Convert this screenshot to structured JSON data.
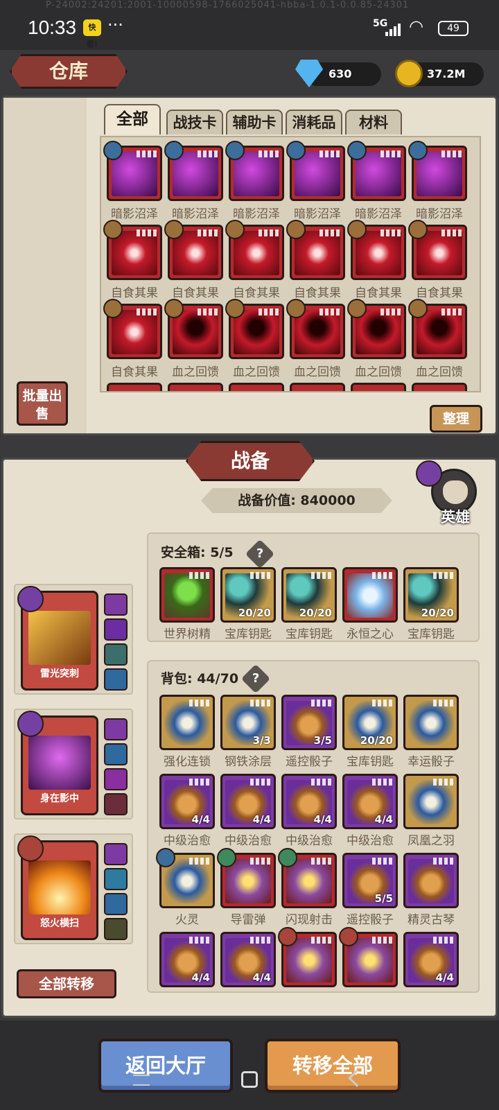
{
  "status_bar": {
    "time": "10:33",
    "app_badge": "快看!",
    "more": "···",
    "build": "P-24002:24201:2001-10000598-1766025041-hbba-1.0.1-0.0.85-24301",
    "network": "5G",
    "battery": "49"
  },
  "header": {
    "title": "仓库",
    "diamonds": "630",
    "gold": "37.2M"
  },
  "tabs": [
    "全部",
    "战技卡",
    "辅助卡",
    "消耗品",
    "材料"
  ],
  "warehouse_items": [
    {
      "label": "暗影沼泽",
      "kind": "purple"
    },
    {
      "label": "暗影沼泽",
      "kind": "purple"
    },
    {
      "label": "暗影沼泽",
      "kind": "purple"
    },
    {
      "label": "暗影沼泽",
      "kind": "purple"
    },
    {
      "label": "暗影沼泽",
      "kind": "purple"
    },
    {
      "label": "暗影沼泽",
      "kind": "purple"
    },
    {
      "label": "自食其果",
      "kind": "shield"
    },
    {
      "label": "自食其果",
      "kind": "shield"
    },
    {
      "label": "自食其果",
      "kind": "shield"
    },
    {
      "label": "自食其果",
      "kind": "shield"
    },
    {
      "label": "自食其果",
      "kind": "shield"
    },
    {
      "label": "自食其果",
      "kind": "shield"
    },
    {
      "label": "自食其果",
      "kind": "shield"
    },
    {
      "label": "血之回馈",
      "kind": "hood"
    },
    {
      "label": "血之回馈",
      "kind": "hood"
    },
    {
      "label": "血之回馈",
      "kind": "hood"
    },
    {
      "label": "血之回馈",
      "kind": "hood"
    },
    {
      "label": "血之回馈",
      "kind": "hood"
    }
  ],
  "buttons": {
    "batch_sell": "批量出售",
    "sort": "整理",
    "transfer_all_small": "全部转移",
    "back_lobby": "返回大厅",
    "transfer_all": "转移全部"
  },
  "equip": {
    "title": "战备",
    "value_label": "战备价值: 840000",
    "hero": "英雄"
  },
  "safe_box": {
    "title": "安全箱: 5/5",
    "help": "?",
    "items": [
      {
        "label": "世界树精",
        "count": ""
      },
      {
        "label": "宝库钥匙",
        "count": "20/20"
      },
      {
        "label": "宝库钥匙",
        "count": "20/20"
      },
      {
        "label": "永恒之心",
        "count": ""
      },
      {
        "label": "宝库钥匙",
        "count": "20/20"
      }
    ]
  },
  "backpack": {
    "title": "背包: 44/70",
    "help": "?",
    "items": [
      {
        "label": "强化连锁",
        "count": "",
        "kind": "gold"
      },
      {
        "label": "钢铁涂层",
        "count": "3/3",
        "kind": "gold"
      },
      {
        "label": "遥控骰子",
        "count": "3/5",
        "kind": "purple"
      },
      {
        "label": "宝库钥匙",
        "count": "20/20",
        "kind": "gold"
      },
      {
        "label": "幸运骰子",
        "count": "",
        "kind": "gold"
      },
      {
        "label": "中级治愈",
        "count": "4/4",
        "kind": "purple"
      },
      {
        "label": "中级治愈",
        "count": "4/4",
        "kind": "purple"
      },
      {
        "label": "中级治愈",
        "count": "4/4",
        "kind": "purple"
      },
      {
        "label": "中级治愈",
        "count": "4/4",
        "kind": "purple"
      },
      {
        "label": "凤凰之羽",
        "count": "",
        "kind": "gold"
      },
      {
        "label": "火灵",
        "count": "",
        "kind": "gold"
      },
      {
        "label": "导雷弹",
        "count": "",
        "kind": "red"
      },
      {
        "label": "闪现射击",
        "count": "",
        "kind": "red"
      },
      {
        "label": "遥控骰子",
        "count": "5/5",
        "kind": "purple"
      },
      {
        "label": "精灵古琴",
        "count": "",
        "kind": "purple"
      },
      {
        "label": "",
        "count": "4/4",
        "kind": "purple"
      },
      {
        "label": "",
        "count": "4/4",
        "kind": "purple"
      },
      {
        "label": "",
        "count": "",
        "kind": "red"
      },
      {
        "label": "",
        "count": "",
        "kind": "red"
      },
      {
        "label": "",
        "count": "4/4",
        "kind": "purple"
      }
    ]
  },
  "skills": [
    {
      "name": "雷光突刺"
    },
    {
      "name": "身在影中"
    },
    {
      "name": "怒火横扫"
    }
  ]
}
